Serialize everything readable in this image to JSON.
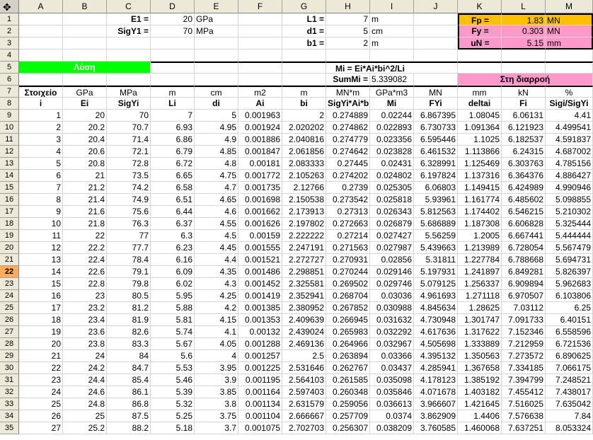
{
  "columns": [
    "A",
    "B",
    "C",
    "D",
    "E",
    "F",
    "G",
    "H",
    "I",
    "J",
    "K",
    "L",
    "M"
  ],
  "highlighted_row": "22",
  "params": {
    "E1_label": "E1 =",
    "E1_value": "20",
    "E1_unit": "GPa",
    "SigY1_label": "SigY1 =",
    "SigY1_value": "70",
    "SigY1_unit": "MPa",
    "L1_label": "L1 =",
    "L1_value": "7",
    "L1_unit": "m",
    "d1_label": "d1 =",
    "d1_value": "5",
    "d1_unit": "cm",
    "b1_label": "b1 =",
    "b1_value": "2",
    "b1_unit": "m",
    "Fp_label": "Fp =",
    "Fp_value": "1.83",
    "Fp_unit": "MN",
    "Fy_label": "Fy =",
    "Fy_value": "0.303",
    "Fy_unit": "MN",
    "uN_label": "uN =",
    "uN_value": "5.15",
    "uN_unit": "mm"
  },
  "solution_label": "Λύση",
  "mi_formula": "Mi = Ei*Ai*bi^2/Li",
  "summi_label": "SumMi =",
  "summi_value": "5.339082",
  "yield_label": "Στη διαρροή",
  "units_row": [
    "Στοιχείο",
    "GPa",
    "MPa",
    "m",
    "cm",
    "m2",
    "m",
    "MN*m",
    "GPa*m3",
    "MN",
    "mm",
    "kN",
    "%"
  ],
  "header_row": [
    "i",
    "Ei",
    "SigYi",
    "Li",
    "di",
    "Ai",
    "bi",
    "SigYi*Ai*bi",
    "Mi",
    "FYi",
    "deltai",
    "Fi",
    "Sigi/SigYi"
  ],
  "data_rows": [
    [
      "1",
      "20",
      "70",
      "7",
      "5",
      "0.001963",
      "2",
      "0.274889",
      "0.02244",
      "6.867395",
      "1.08045",
      "6.06131",
      "4.41"
    ],
    [
      "2",
      "20.2",
      "70.7",
      "6.93",
      "4.95",
      "0.001924",
      "2.020202",
      "0.274862",
      "0.022893",
      "6.730733",
      "1.091364",
      "6.121923",
      "4.499541"
    ],
    [
      "3",
      "20.4",
      "71.4",
      "6.86",
      "4.9",
      "0.001886",
      "2.040816",
      "0.274779",
      "0.023356",
      "6.595446",
      "1.1025",
      "6.182537",
      "4.591837"
    ],
    [
      "4",
      "20.6",
      "72.1",
      "6.79",
      "4.85",
      "0.001847",
      "2.061856",
      "0.274642",
      "0.023828",
      "6.461532",
      "1.113866",
      "6.24315",
      "4.687002"
    ],
    [
      "5",
      "20.8",
      "72.8",
      "6.72",
      "4.8",
      "0.00181",
      "2.083333",
      "0.27445",
      "0.02431",
      "6.328991",
      "1.125469",
      "6.303763",
      "4.785156"
    ],
    [
      "6",
      "21",
      "73.5",
      "6.65",
      "4.75",
      "0.001772",
      "2.105263",
      "0.274202",
      "0.024802",
      "6.197824",
      "1.137316",
      "6.364376",
      "4.886427"
    ],
    [
      "7",
      "21.2",
      "74.2",
      "6.58",
      "4.7",
      "0.001735",
      "2.12766",
      "0.2739",
      "0.025305",
      "6.06803",
      "1.149415",
      "6.424989",
      "4.990946"
    ],
    [
      "8",
      "21.4",
      "74.9",
      "6.51",
      "4.65",
      "0.001698",
      "2.150538",
      "0.273542",
      "0.025818",
      "5.93961",
      "1.161774",
      "6.485602",
      "5.098855"
    ],
    [
      "9",
      "21.6",
      "75.6",
      "6.44",
      "4.6",
      "0.001662",
      "2.173913",
      "0.27313",
      "0.026343",
      "5.812563",
      "1.174402",
      "6.546215",
      "5.210302"
    ],
    [
      "10",
      "21.8",
      "76.3",
      "6.37",
      "4.55",
      "0.001626",
      "2.197802",
      "0.272663",
      "0.026879",
      "5.686889",
      "1.187308",
      "6.606828",
      "5.325444"
    ],
    [
      "11",
      "22",
      "77",
      "6.3",
      "4.5",
      "0.00159",
      "2.222222",
      "0.27214",
      "0.027427",
      "5.56259",
      "1.2005",
      "6.667441",
      "5.444444"
    ],
    [
      "12",
      "22.2",
      "77.7",
      "6.23",
      "4.45",
      "0.001555",
      "2.247191",
      "0.271563",
      "0.027987",
      "5.439663",
      "1.213989",
      "6.728054",
      "5.567479"
    ],
    [
      "13",
      "22.4",
      "78.4",
      "6.16",
      "4.4",
      "0.001521",
      "2.272727",
      "0.270931",
      "0.02856",
      "5.31811",
      "1.227784",
      "6.788668",
      "5.694731"
    ],
    [
      "14",
      "22.6",
      "79.1",
      "6.09",
      "4.35",
      "0.001486",
      "2.298851",
      "0.270244",
      "0.029146",
      "5.197931",
      "1.241897",
      "6.849281",
      "5.826397"
    ],
    [
      "15",
      "22.8",
      "79.8",
      "6.02",
      "4.3",
      "0.001452",
      "2.325581",
      "0.269502",
      "0.029746",
      "5.079125",
      "1.256337",
      "6.909894",
      "5.962683"
    ],
    [
      "16",
      "23",
      "80.5",
      "5.95",
      "4.25",
      "0.001419",
      "2.352941",
      "0.268704",
      "0.03036",
      "4.961693",
      "1.271118",
      "6.970507",
      "6.103806"
    ],
    [
      "17",
      "23.2",
      "81.2",
      "5.88",
      "4.2",
      "0.001385",
      "2.380952",
      "0.267852",
      "0.030988",
      "4.845634",
      "1.28625",
      "7.03112",
      "6.25"
    ],
    [
      "18",
      "23.4",
      "81.9",
      "5.81",
      "4.15",
      "0.001353",
      "2.409639",
      "0.266945",
      "0.031632",
      "4.730948",
      "1.301747",
      "7.091733",
      "6.40151"
    ],
    [
      "19",
      "23.6",
      "82.6",
      "5.74",
      "4.1",
      "0.00132",
      "2.439024",
      "0.265983",
      "0.032292",
      "4.617636",
      "1.317622",
      "7.152346",
      "6.558596"
    ],
    [
      "20",
      "23.8",
      "83.3",
      "5.67",
      "4.05",
      "0.001288",
      "2.469136",
      "0.264966",
      "0.032967",
      "4.505698",
      "1.333889",
      "7.212959",
      "6.721536"
    ],
    [
      "21",
      "24",
      "84",
      "5.6",
      "4",
      "0.001257",
      "2.5",
      "0.263894",
      "0.03366",
      "4.395132",
      "1.350563",
      "7.273572",
      "6.890625"
    ],
    [
      "22",
      "24.2",
      "84.7",
      "5.53",
      "3.95",
      "0.001225",
      "2.531646",
      "0.262767",
      "0.03437",
      "4.285941",
      "1.367658",
      "7.334185",
      "7.066175"
    ],
    [
      "23",
      "24.4",
      "85.4",
      "5.46",
      "3.9",
      "0.001195",
      "2.564103",
      "0.261585",
      "0.035098",
      "4.178123",
      "1.385192",
      "7.394799",
      "7.248521"
    ],
    [
      "24",
      "24.6",
      "86.1",
      "5.39",
      "3.85",
      "0.001164",
      "2.597403",
      "0.260348",
      "0.035846",
      "4.071678",
      "1.403182",
      "7.455412",
      "7.438017"
    ],
    [
      "25",
      "24.8",
      "86.8",
      "5.32",
      "3.8",
      "0.001134",
      "2.631579",
      "0.259056",
      "0.036613",
      "3.966607",
      "1.421645",
      "7.516025",
      "7.635042"
    ],
    [
      "26",
      "25",
      "87.5",
      "5.25",
      "3.75",
      "0.001104",
      "2.666667",
      "0.257709",
      "0.0374",
      "3.862909",
      "1.4406",
      "7.576638",
      "7.84"
    ],
    [
      "27",
      "25.2",
      "88.2",
      "5.18",
      "3.7",
      "0.001075",
      "2.702703",
      "0.256307",
      "0.038209",
      "3.760585",
      "1.460068",
      "7.637251",
      "8.053324"
    ]
  ]
}
